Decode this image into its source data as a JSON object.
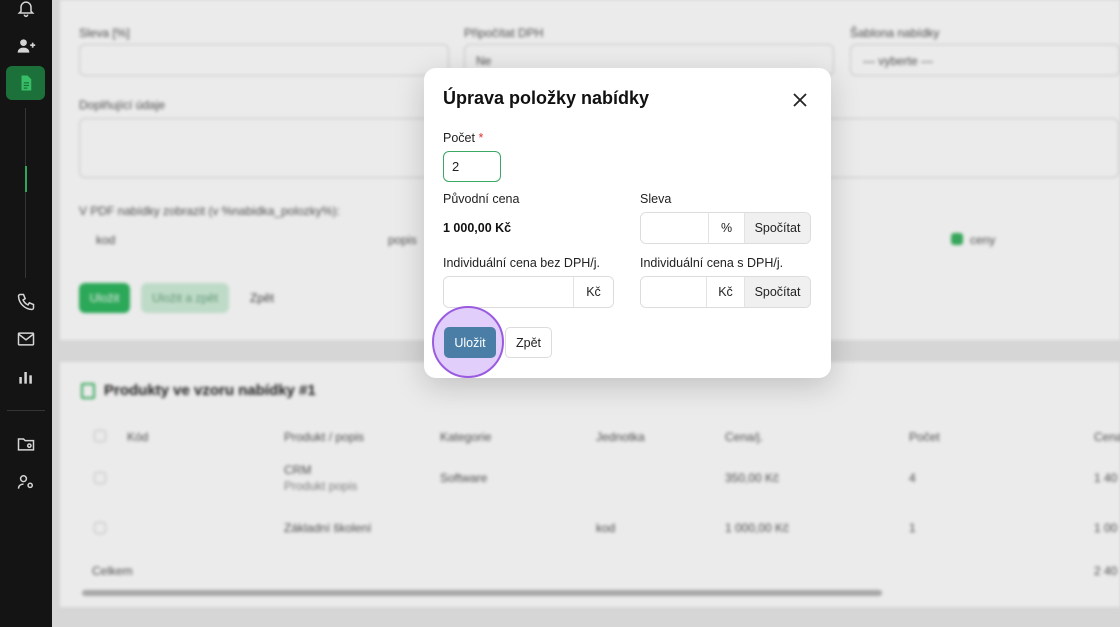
{
  "background": {
    "field_sleva": "Sleva [%]",
    "field_dph": "Připočítat DPH",
    "dph_value": "Ne",
    "field_sablona": "Šablona nabídky",
    "sablona_value": "--- vyberte ---",
    "field_doplnujici": "Doplňující údaje",
    "pdf_label": "V PDF nabídky zobrazit (v %nabidka_polozky%):",
    "col_kod": "kod",
    "col_popis": "popis",
    "col_ceny": "ceny",
    "btn_ulozit": "Uložit",
    "btn_ulozit_zpet": "Uložit a zpět",
    "btn_zpet": "Zpět",
    "products_title": "Produkty ve vzoru nabídky #1",
    "table_headers": [
      "Kód",
      "Produkt / popis",
      "Kategorie",
      "Jednotka",
      "Cena/j.",
      "Počet",
      "Cena"
    ],
    "rows": [
      {
        "product": "CRM",
        "desc": "Produkt popis",
        "category": "Software",
        "unit": "",
        "price": "350,00 Kč",
        "count": "4",
        "total": "1 40"
      },
      {
        "product": "Základní školení",
        "desc": "",
        "category": "",
        "unit": "kod",
        "price": "1 000,00 Kč",
        "count": "1",
        "total": "1 00"
      }
    ],
    "total_label": "Celkem",
    "total_value": "2 40"
  },
  "modal": {
    "title": "Úprava položky nabídky",
    "count_label": "Počet",
    "count_required": "*",
    "count_value": "2",
    "original_price_label": "Původní cena",
    "original_price_value": "1 000,00 Kč",
    "discount_label": "Sleva",
    "discount_unit": "%",
    "calc_label": "Spočítat",
    "price_without_vat_label": "Individuální cena bez DPH/j.",
    "price_with_vat_label": "Individuální cena s DPH/j.",
    "currency": "Kč",
    "save_label": "Uložit",
    "back_label": "Zpět"
  }
}
